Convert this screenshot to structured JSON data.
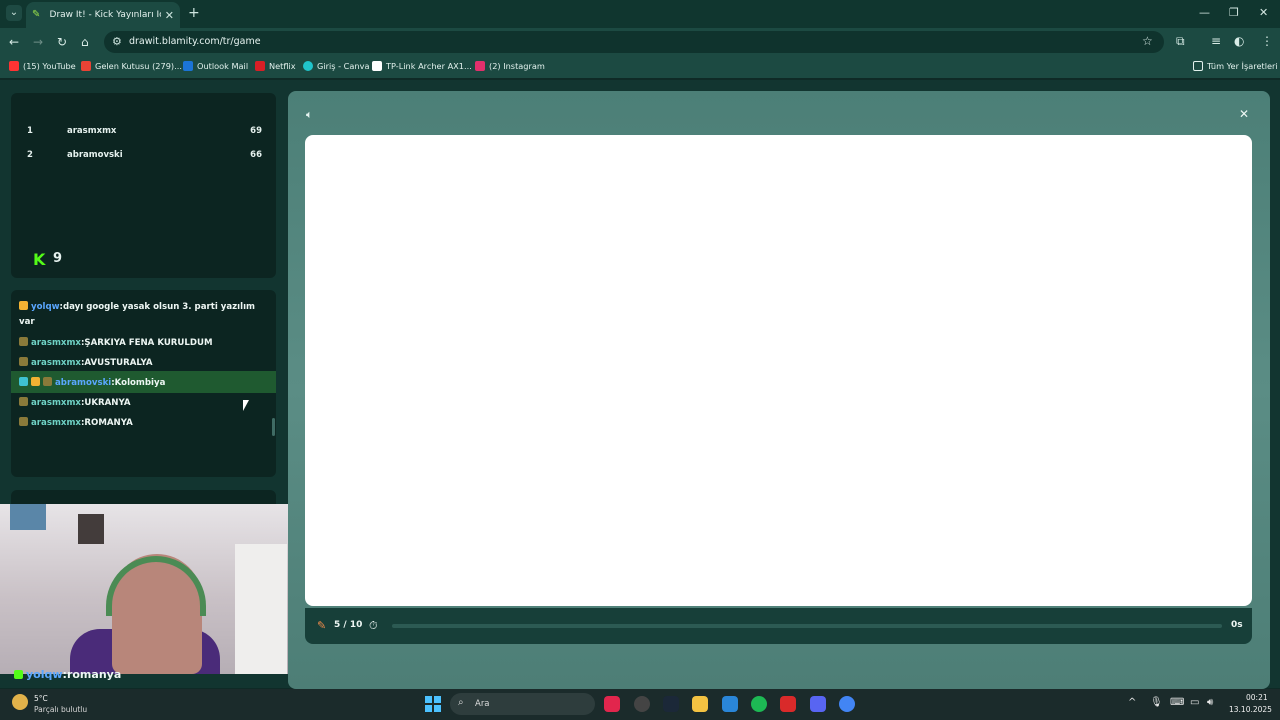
{
  "browser": {
    "tab_title": "Draw It! - Kick Yayınları İçin Çizi",
    "url": "drawit.blamity.com/tr/game",
    "bookmarks": [
      {
        "label": "(15) YouTube",
        "color": "#ff3333"
      },
      {
        "label": "Gelen Kutusu (279)...",
        "color": "#ea4335"
      },
      {
        "label": "Outlook Mail",
        "color": "#1b74d6"
      },
      {
        "label": "Netflix",
        "color": "#d81f26"
      },
      {
        "label": "Giriş - Canva",
        "color": "#20c4cb"
      },
      {
        "label": "TP-Link Archer AX1...",
        "color": "#ffffff"
      },
      {
        "label": "(2) Instagram",
        "color": "#e1306c"
      }
    ],
    "all_bookmarks_label": "Tüm Yer İşaretleri"
  },
  "leaderboard": {
    "rows": [
      {
        "rank": "1",
        "name": "arasmxmx",
        "score": "69"
      },
      {
        "rank": "2",
        "name": "abramovski",
        "score": "66"
      }
    ],
    "kick_count": "9"
  },
  "chat": {
    "messages": [
      {
        "user": "yolqw",
        "text": ":dayı google yasak olsun 3. parti yazılım",
        "cont": "var"
      },
      {
        "user": "arasmxmx",
        "text": ":ŞARKIYA FENA KURULDUM"
      },
      {
        "user": "arasmxmx",
        "text": ":AVUSTURALYA"
      },
      {
        "user": "abramovski",
        "text": ":Kolombiya"
      },
      {
        "user": "arasmxmx",
        "text": ":UKRANYA"
      },
      {
        "user": "arasmxmx",
        "text": ":ROMANYA"
      }
    ]
  },
  "webcam_caption": {
    "user": "yolqw",
    "text": ":romanya"
  },
  "game": {
    "round": "5 / 10",
    "time": "0s",
    "progress": 0
  },
  "taskbar": {
    "weather_temp": "5°C",
    "weather_desc": "Parçalı bulutlu",
    "search_placeholder": "Ara",
    "time": "00:21",
    "date": "13.10.2025"
  }
}
